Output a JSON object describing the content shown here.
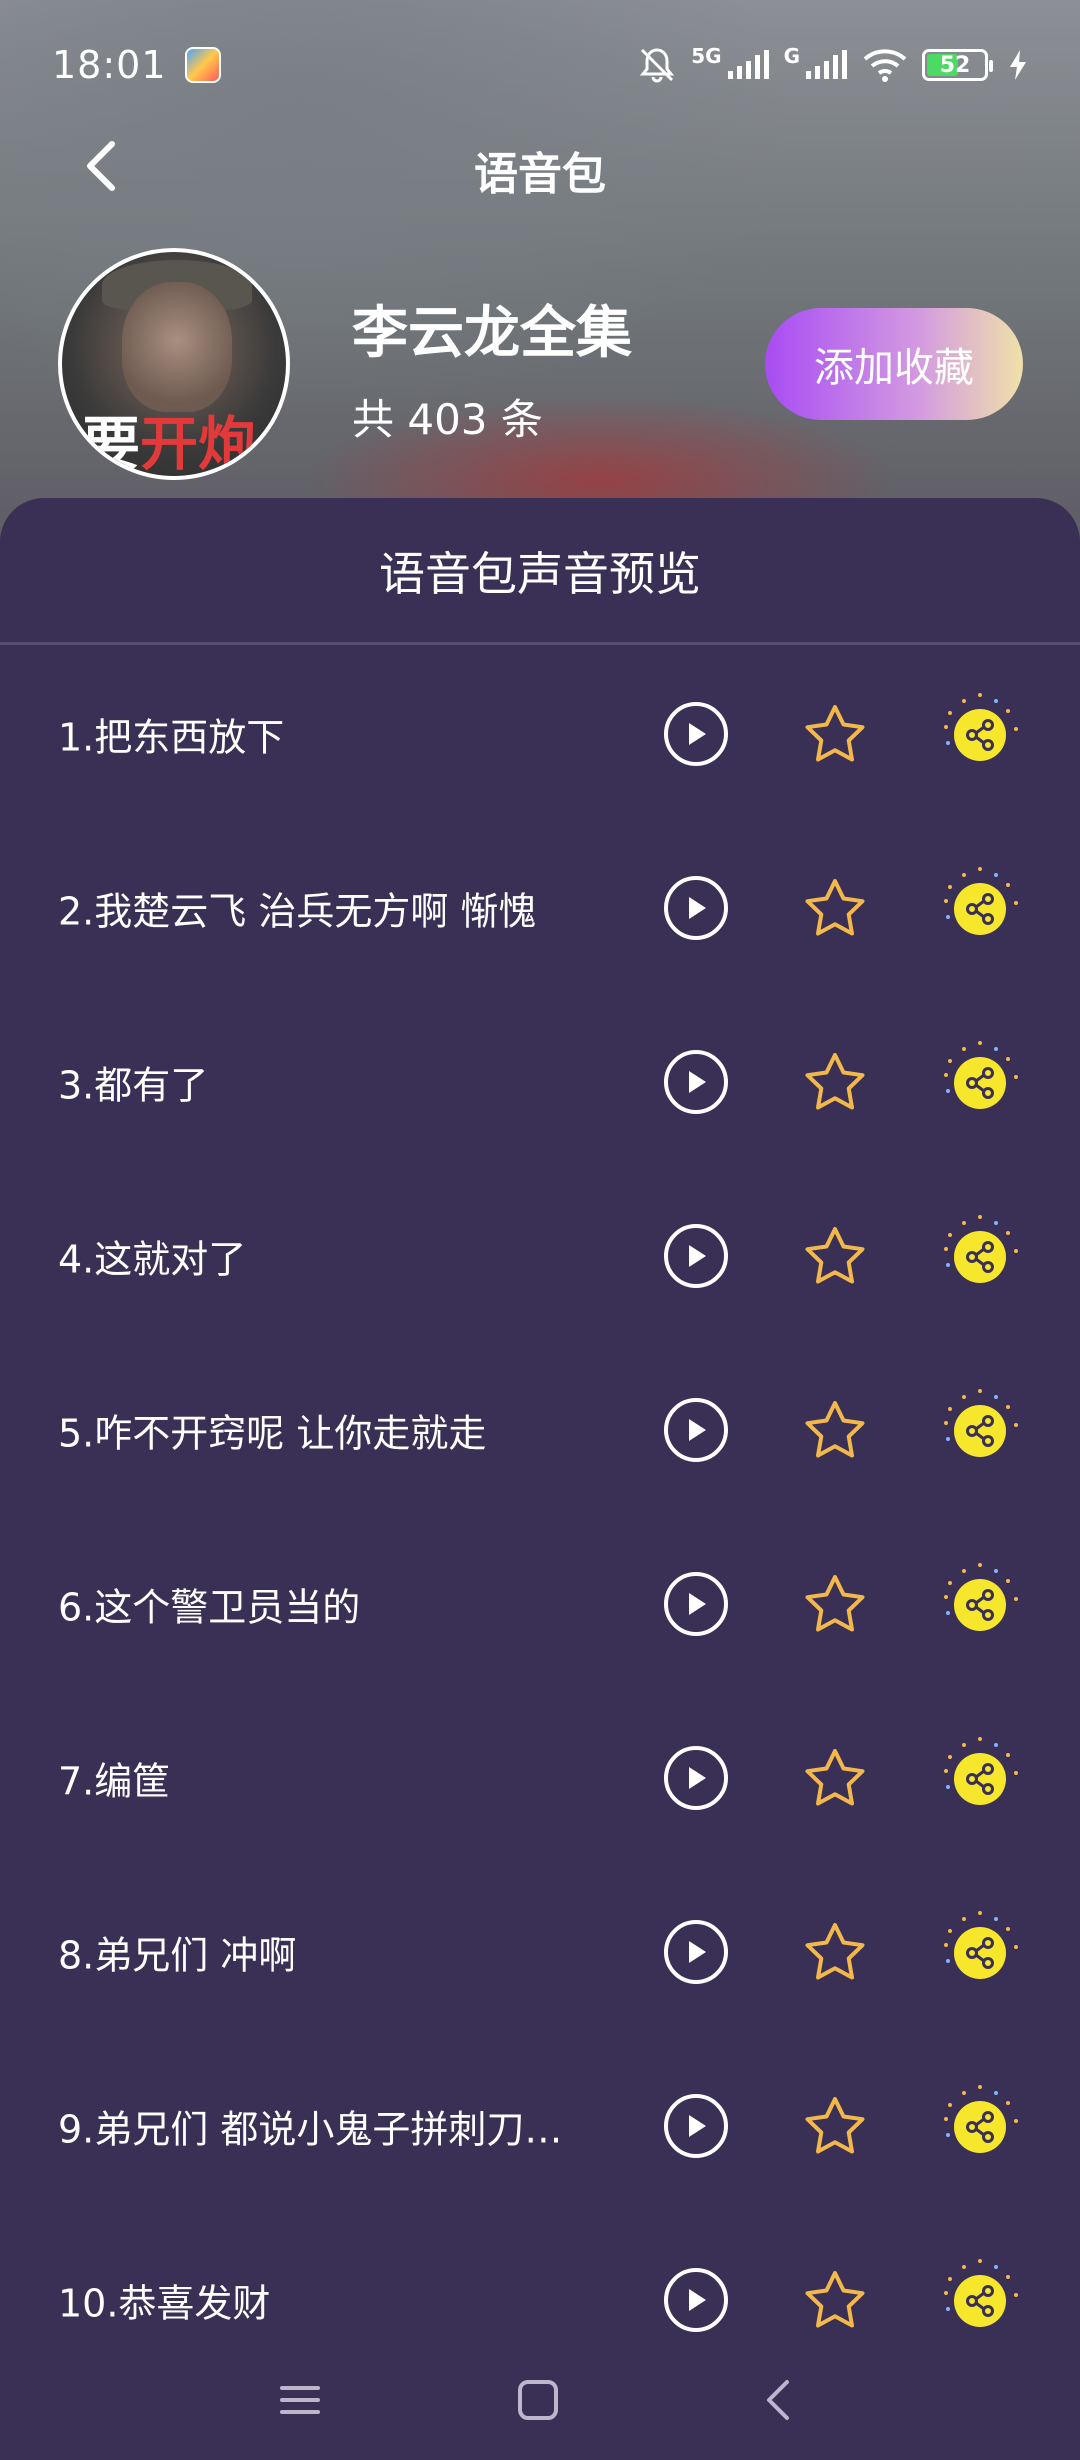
{
  "status": {
    "time": "18:01",
    "network_1": "5G",
    "network_2": "G",
    "battery": "52"
  },
  "nav": {
    "title": "语音包"
  },
  "pack": {
    "name": "李云龙全集",
    "count": "共 403 条",
    "favorite_label": "添加收藏",
    "avatar_caption_1": "要",
    "avatar_caption_2": "开炮"
  },
  "panel": {
    "title": "语音包声音预览"
  },
  "items": [
    {
      "label": "1.把东西放下"
    },
    {
      "label": "2.我楚云飞 治兵无方啊 惭愧"
    },
    {
      "label": "3.都有了"
    },
    {
      "label": "4.这就对了"
    },
    {
      "label": "5.咋不开窍呢 让你走就走"
    },
    {
      "label": "6.这个警卫员当的"
    },
    {
      "label": "7.编筐"
    },
    {
      "label": "8.弟兄们 冲啊"
    },
    {
      "label": "9.弟兄们 都说小鬼子拼刺刀…"
    },
    {
      "label": "10.恭喜发财"
    }
  ],
  "icons": {
    "back": "chevron-left-icon",
    "play": "play-icon",
    "star": "star-icon",
    "share": "share-icon",
    "menu": "menu-icon",
    "home": "square-icon",
    "sys_back": "chevron-left-icon"
  },
  "colors": {
    "panel_bg": "#3a2f55",
    "star": "#f2b84b",
    "share": "#f6e62c",
    "favorite_start": "#a84cf4",
    "favorite_end": "#efe1a9"
  }
}
